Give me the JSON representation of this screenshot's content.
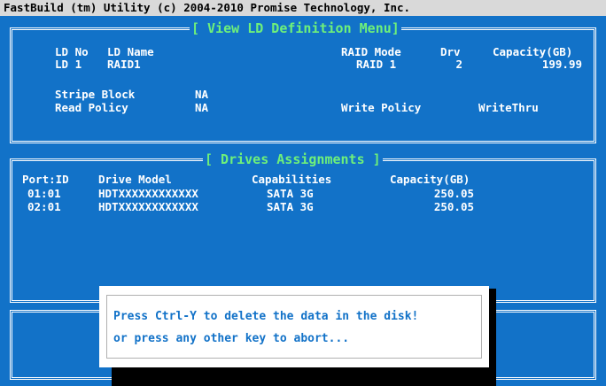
{
  "title_bar": "FastBuild (tm) Utility (c) 2004-2010 Promise Technology, Inc.",
  "ld_menu": {
    "title": "[ View LD Definition Menu]",
    "headers": {
      "ld_no": "LD No",
      "ld_name": "LD Name",
      "raid_mode": "RAID Mode",
      "drv": "Drv",
      "capacity": "Capacity(GB)"
    },
    "row": {
      "ld_no": "LD  1",
      "ld_name": "RAID1",
      "raid_mode": "RAID 1",
      "drv": "2",
      "capacity": "199.99"
    },
    "stripe_block_label": "Stripe Block",
    "stripe_block_value": "NA",
    "read_policy_label": "Read Policy",
    "read_policy_value": "NA",
    "write_policy_label": "Write Policy",
    "write_policy_value": "WriteThru"
  },
  "drives": {
    "title": "[ Drives Assignments ]",
    "headers": {
      "port_id": "Port:ID",
      "model": "Drive Model",
      "capabilities": "Capabilities",
      "capacity": "Capacity(GB)"
    },
    "rows": [
      {
        "port_id": "01:01",
        "model": "HDTXXXXXXXXXXXX",
        "capabilities": "SATA 3G",
        "capacity": "250.05"
      },
      {
        "port_id": "02:01",
        "model": "HDTXXXXXXXXXXXX",
        "capabilities": "SATA 3G",
        "capacity": "250.05"
      }
    ]
  },
  "dialog": {
    "line1": "Press Ctrl-Y to delete the data in the disk!",
    "line2": "or press any other key to abort..."
  },
  "colors": {
    "background": "#1272c8",
    "box_title": "#6ef07a",
    "text": "#ffffff",
    "dialog_text": "#1272c8"
  }
}
